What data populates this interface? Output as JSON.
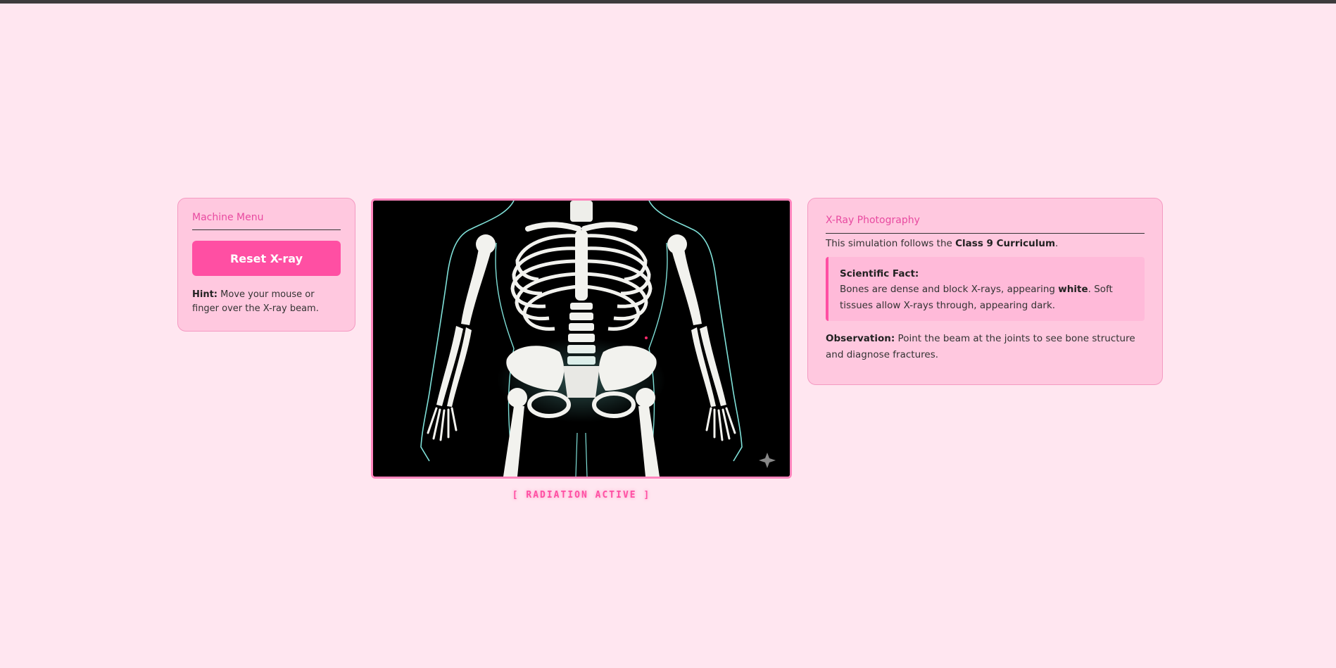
{
  "machine_menu": {
    "title": "Machine Menu",
    "reset_label": "Reset X-ray",
    "hint_label": "Hint:",
    "hint_text": " Move your mouse or finger over the X-ray beam."
  },
  "xray": {
    "status": "[ RADIATION ACTIVE ]",
    "beam_color": "#ff2a6d",
    "bone_color": "#f2f2ee",
    "outline_color": "#7fe0d8"
  },
  "info": {
    "title": "X-Ray Photography",
    "intro_prefix": "This simulation follows the ",
    "intro_bold": "Class 9 Curriculum",
    "intro_suffix": ".",
    "fact_title": "Scientific Fact:",
    "fact_prefix": "Bones are dense and block X-rays, appearing ",
    "fact_bold": "white",
    "fact_suffix": ". Soft tissues allow X-rays through, appearing dark.",
    "observation_label": "Observation:",
    "observation_text": " Point the beam at the joints to see bone structure and diagnose fractures."
  },
  "colors": {
    "background": "#ffe6f0",
    "panel": "#ffc8df",
    "accent": "#ff4fa3",
    "title_pink": "#e84aa0"
  }
}
